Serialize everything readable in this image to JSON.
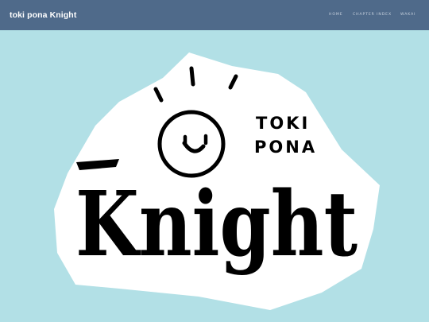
{
  "header": {
    "site_title": "toki pona Knight",
    "nav": [
      "HOME",
      "CHAPTER INDEX",
      "WAKAI"
    ]
  },
  "hero": {
    "logo_word": "Knight",
    "logo_subtitle_line1": "TOKI",
    "logo_subtitle_line2": "PONA"
  },
  "colors": {
    "header_bg": "#4f6a8a",
    "page_bg": "#b2e0e6",
    "blob": "#ffffff",
    "ink": "#000000"
  }
}
